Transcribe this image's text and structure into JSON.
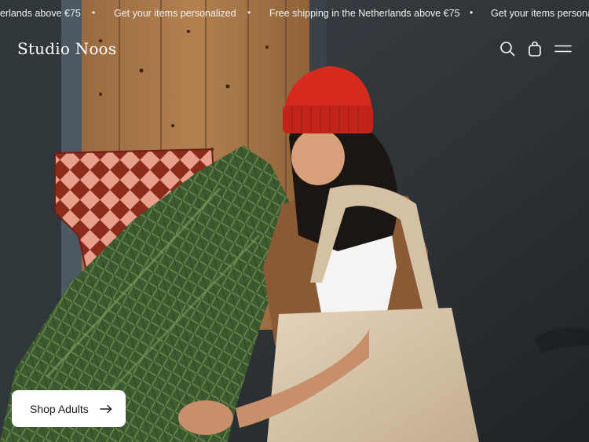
{
  "announcement_bar": {
    "messages": [
      "erlands above €75",
      "Get your items personalized",
      "Free shipping in the Netherlands above €75",
      "Get your items personali"
    ],
    "separator": "•"
  },
  "header": {
    "logo": "Studio Noos",
    "icons": [
      "search-icon",
      "bag-icon",
      "menu-icon"
    ]
  },
  "hero": {
    "cta_label": "Shop Adults",
    "cta_icon": "arrow-right-icon"
  },
  "colors": {
    "beanie_red": "#d62a1e",
    "wood": "#a9774a",
    "wall": "#2c3033",
    "tote": "#d9c7ad",
    "tree_green": "#4c6b3a",
    "cta_bg": "#ffffff"
  }
}
